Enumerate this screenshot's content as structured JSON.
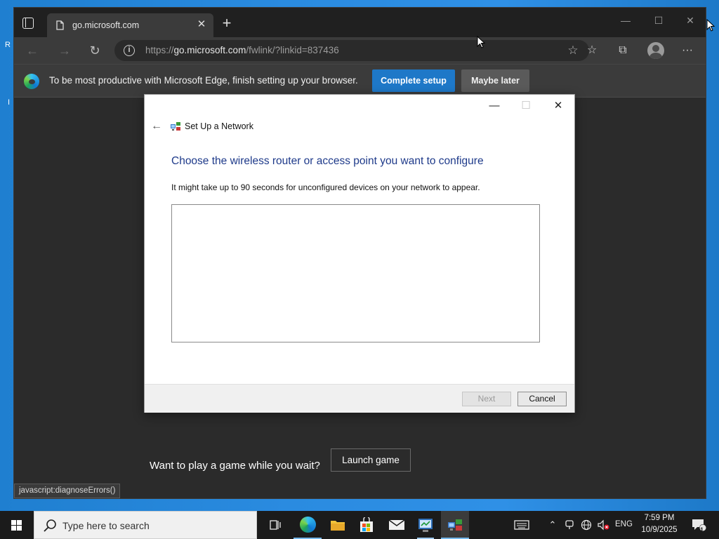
{
  "browser": {
    "tab": {
      "title": "go.microsoft.com",
      "close_glyph": "✕",
      "favicon": "page-icon"
    },
    "new_tab_glyph": "+",
    "window_controls": {
      "minimize": "—",
      "maximize": "☐",
      "close": "✕"
    },
    "nav": {
      "back_glyph": "←",
      "forward_glyph": "→",
      "refresh_glyph": "↻"
    },
    "address": {
      "scheme": "https://",
      "domain": "go.microsoft.com",
      "path": "/fwlink/?linkid=837436",
      "info_glyph": "i",
      "favorite_glyph": "☆"
    },
    "toolbar": {
      "favorites_glyph": "☆",
      "collections_glyph": "⧉",
      "menu_glyph": "···"
    },
    "infobar": {
      "message": "To be most productive with Microsoft Edge, finish setting up your browser.",
      "primary_label": "Complete setup",
      "secondary_label": "Maybe later"
    },
    "page": {
      "game_prompt": "Want to play a game while you wait?",
      "launch_label": "Launch game",
      "status_url": "javascript:diagnoseErrors()"
    }
  },
  "dialog": {
    "title": "Set Up a Network",
    "heading": "Choose the wireless router or access point you want to configure",
    "description": "It might take up to 90 seconds for unconfigured devices on your network to appear.",
    "controls": {
      "minimize": "—",
      "maximize": "☐",
      "close": "✕"
    },
    "back_glyph": "←",
    "next_label": "Next",
    "cancel_label": "Cancel",
    "devices": []
  },
  "taskbar": {
    "search_placeholder": "Type here to search",
    "tray": {
      "language": "ENG",
      "notification_count": "1",
      "chevron": "⌃"
    },
    "clock": {
      "time": "7:59 PM",
      "date": "10/9/2025"
    }
  },
  "colors": {
    "accent": "#1e78c8",
    "dialog_heading": "#1e3a8a",
    "desktop": "#2a8be0",
    "taskbar": "#1b1b1b"
  }
}
